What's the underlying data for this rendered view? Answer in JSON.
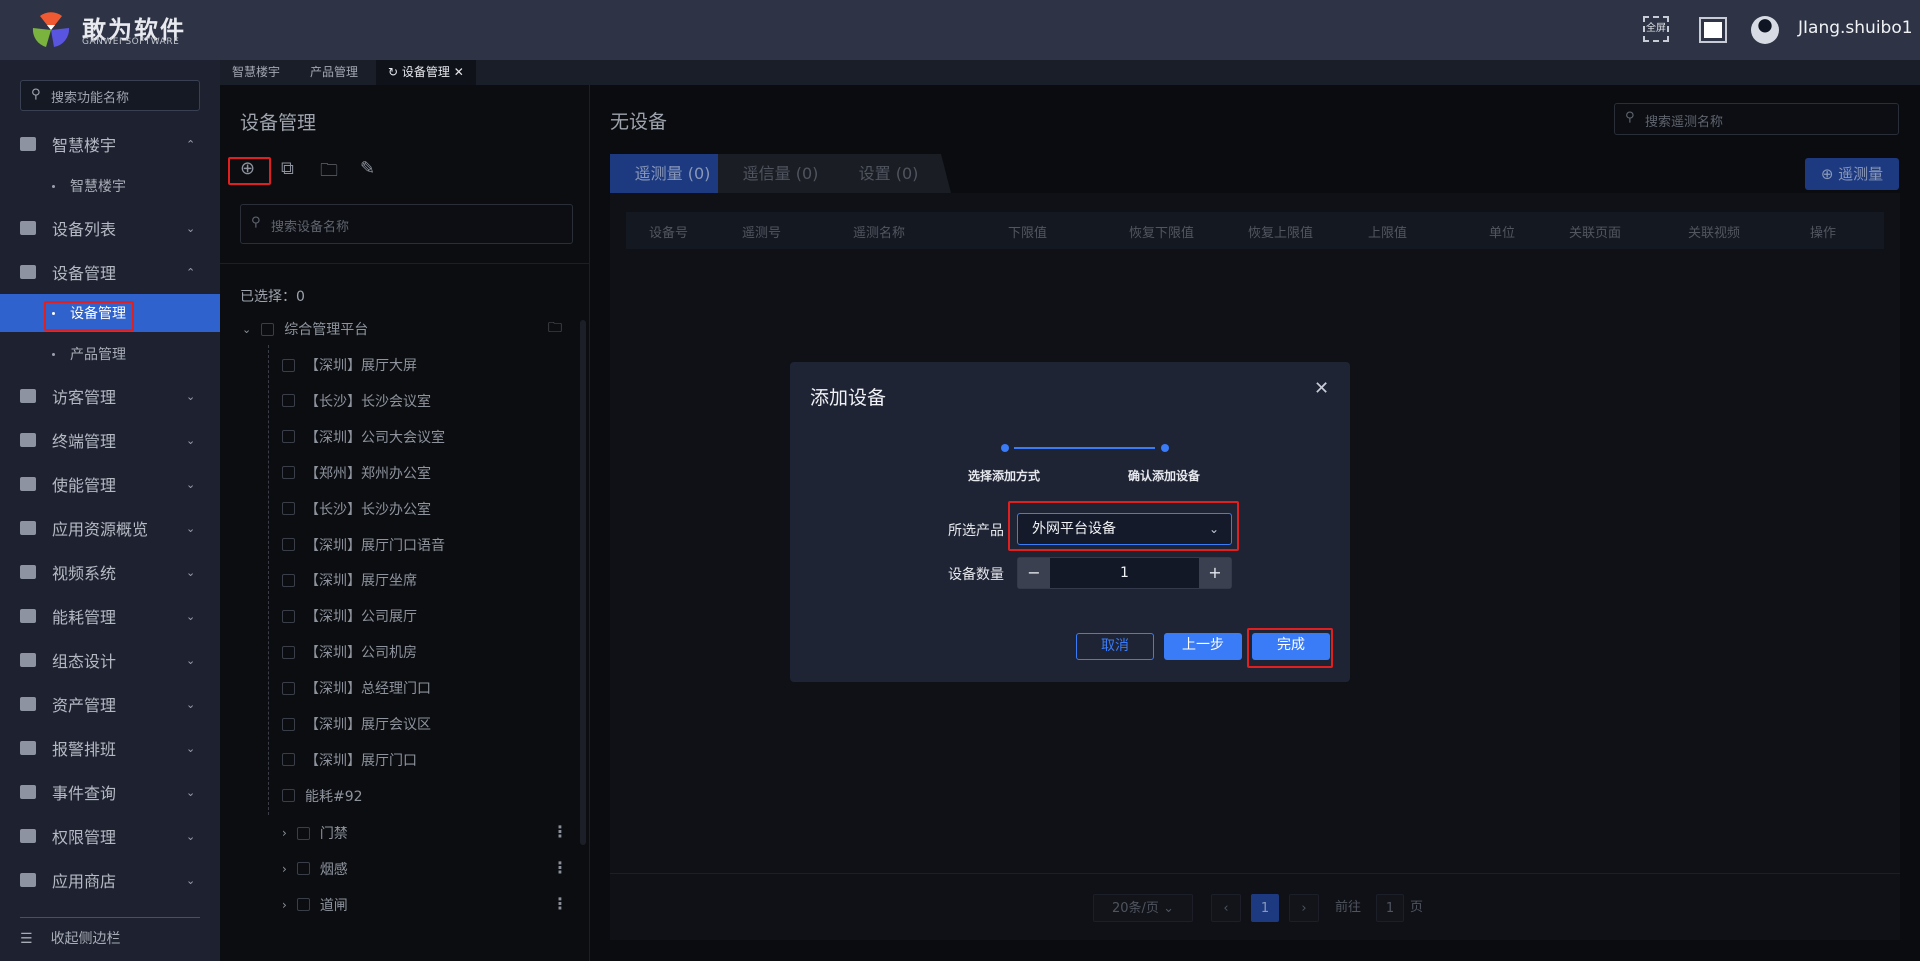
{
  "header": {
    "brand": "敢为软件",
    "brand_sub": "GANWEI SOFTWARE",
    "fullscreen_label": "全屏",
    "user": "JIang.shuibo1"
  },
  "sidebar": {
    "search_placeholder": "搜索功能名称",
    "items": [
      {
        "label": "智慧楼宇",
        "expanded": true,
        "subs": [
          "智慧楼宇"
        ]
      },
      {
        "label": "设备列表"
      },
      {
        "label": "设备管理",
        "expanded": true,
        "subs": [
          "设备管理",
          "产品管理"
        ],
        "active_sub": 0
      },
      {
        "label": "访客管理"
      },
      {
        "label": "终端管理"
      },
      {
        "label": "使能管理"
      },
      {
        "label": "应用资源概览"
      },
      {
        "label": "视频系统"
      },
      {
        "label": "能耗管理"
      },
      {
        "label": "组态设计"
      },
      {
        "label": "资产管理"
      },
      {
        "label": "报警排班"
      },
      {
        "label": "事件查询"
      },
      {
        "label": "权限管理"
      },
      {
        "label": "应用商店"
      }
    ],
    "collapse_label": "收起侧边栏"
  },
  "tabs": [
    {
      "label": "智慧楼宇"
    },
    {
      "label": "产品管理"
    },
    {
      "label": "设备管理",
      "active": true
    }
  ],
  "tree": {
    "title": "设备管理",
    "search_placeholder": "搜索设备名称",
    "selected_label": "已选择：0",
    "root": "综合管理平台",
    "items": [
      "【深圳】展厅大屏",
      "【长沙】长沙会议室",
      "【深圳】公司大会议室",
      "【郑州】郑州办公室",
      "【长沙】长沙办公室",
      "【深圳】展厅门口语音",
      "【深圳】展厅坐席",
      "【深圳】公司展厅",
      "【深圳】公司机房",
      "【深圳】总经理门口",
      "【深圳】展厅会议区",
      "【深圳】展厅门口",
      "能耗#92"
    ],
    "groups": [
      "门禁",
      "烟感",
      "道闸"
    ]
  },
  "main": {
    "title": "无设备",
    "search_placeholder": "搜索遥测名称",
    "tabs": [
      "遥测量 (0)",
      "遥信量 (0)",
      "设置 (0)"
    ],
    "add_button": "遥测量",
    "columns": [
      "设备号",
      "遥测号",
      "遥测名称",
      "下限值",
      "恢复下限值",
      "恢复上限值",
      "上限值",
      "单位",
      "关联页面",
      "关联视频",
      "操作"
    ],
    "pagination": {
      "page_size": "20条/页",
      "current": "1",
      "goto_label": "前往",
      "goto_value": "1",
      "page_suffix": "页"
    }
  },
  "modal": {
    "title": "添加设备",
    "steps": [
      "选择添加方式",
      "确认添加设备"
    ],
    "product_label": "所选产品",
    "product_value": "外网平台设备",
    "count_label": "设备数量",
    "count_value": "1",
    "cancel": "取消",
    "prev": "上一步",
    "finish": "完成"
  },
  "colors": {
    "accent": "#3a7bf7",
    "highlight": "#e02020"
  }
}
